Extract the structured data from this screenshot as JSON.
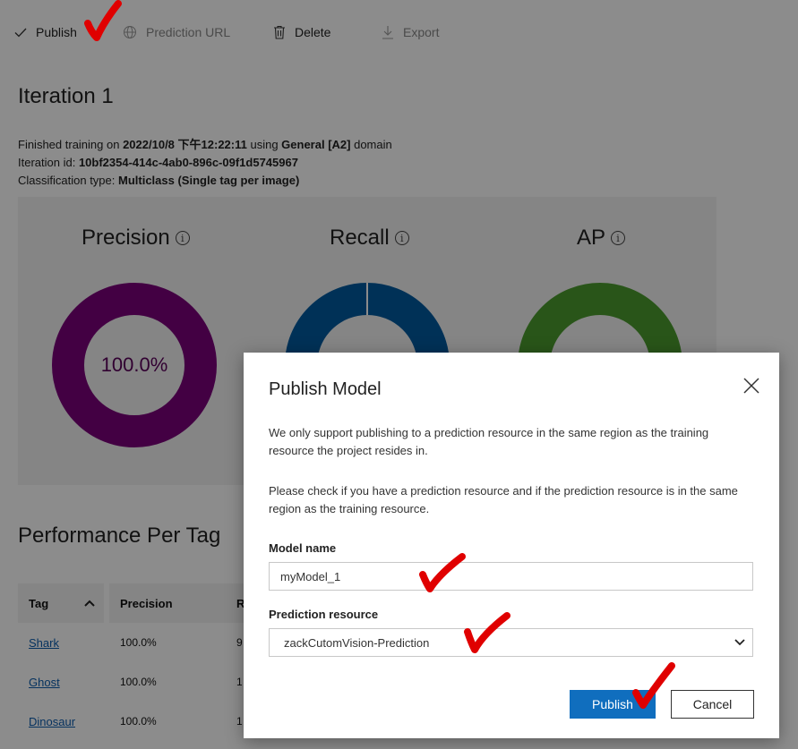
{
  "toolbar": {
    "publish": "Publish",
    "prediction_url": "Prediction URL",
    "delete": "Delete",
    "export": "Export"
  },
  "iteration": {
    "title": "Iteration 1",
    "finished_prefix": "Finished training on ",
    "finished_date": "2022/10/8 下午12:22:11",
    "finished_mid": " using ",
    "domain_name": "General [A2]",
    "finished_suffix": " domain",
    "id_label": "Iteration id: ",
    "id_value": "10bf2354-414c-4ab0-896c-09f1d5745967",
    "class_label": "Classification type: ",
    "class_value": "Multiclass (Single tag per image)"
  },
  "metrics": {
    "precision": {
      "title": "Precision",
      "value": "100.0%",
      "color": "#7a007a"
    },
    "recall": {
      "title": "Recall",
      "color": "#005a9e"
    },
    "ap": {
      "title": "AP",
      "color": "#4c9c2e"
    }
  },
  "performance": {
    "title": "Performance Per Tag",
    "headers": {
      "tag": "Tag",
      "precision": "Precision",
      "recall": "R"
    },
    "rows": [
      {
        "tag": "Shark",
        "precision": "100.0%",
        "recall": "9"
      },
      {
        "tag": "Ghost",
        "precision": "100.0%",
        "recall": "1"
      },
      {
        "tag": "Dinosaur",
        "precision": "100.0%",
        "recall": "1"
      }
    ]
  },
  "modal": {
    "title": "Publish Model",
    "text1": "We only support publishing to a prediction resource in the same region as the training resource the project resides in.",
    "text2": "Please check if you have a prediction resource and if the prediction resource is in the same region as the training resource.",
    "model_name_label": "Model name",
    "model_name_value": "myModel_1",
    "prediction_resource_label": "Prediction resource",
    "prediction_resource_value": "zackCutomVision-Prediction",
    "publish_button": "Publish",
    "cancel_button": "Cancel"
  },
  "colors": {
    "primary": "#106ebe",
    "annotation_red": "#e00000"
  }
}
